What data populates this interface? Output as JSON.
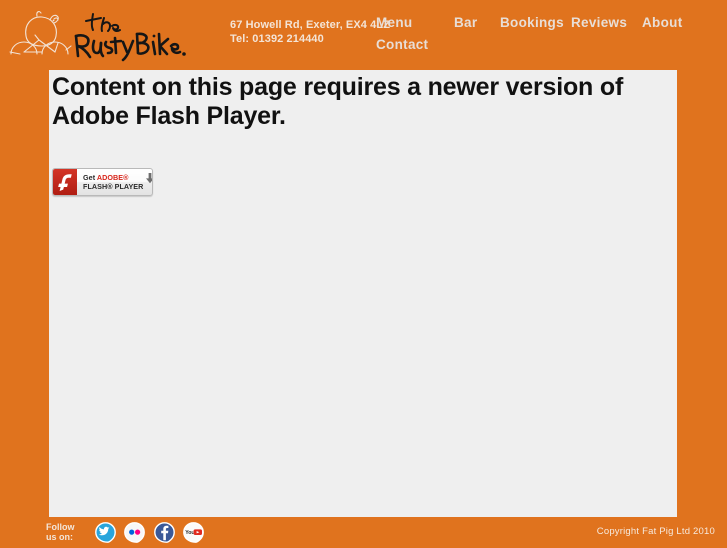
{
  "colors": {
    "brand_orange": "#e0731e",
    "content_background": "#efefef",
    "heading_text": "#111111",
    "nav_text": "#e8ded6",
    "flash_red": "#d8251b",
    "twitter_blue": "#1b9ad6",
    "facebook_blue": "#3b5998",
    "youtube_red": "#e02a20",
    "flickr_pink": "#ff0084"
  },
  "header": {
    "logo": {
      "mark_name": "pig-on-bicycle-drawing",
      "wordmark_text": "The Rusty Bike."
    },
    "contact": {
      "address": "67 Howell Rd, Exeter, EX4 4LZ",
      "telephone": "Tel: 01392 214440"
    },
    "nav": [
      {
        "id": "menu",
        "label": "Menu"
      },
      {
        "id": "bar",
        "label": "Bar"
      },
      {
        "id": "bookings",
        "label": "Bookings"
      },
      {
        "id": "reviews",
        "label": "Reviews"
      },
      {
        "id": "about",
        "label": "About"
      },
      {
        "id": "contact",
        "label": "Contact"
      }
    ]
  },
  "main": {
    "heading": "Content on this page requires a newer version of Adobe Flash Player.",
    "flash_badge": {
      "icon_name": "adobe-flash-logo-icon",
      "line1_prefix": "Get ",
      "line1_brand": "ADOBE®",
      "line2": "FLASH® PLAYER",
      "download_icon_name": "download-arrow-icon"
    }
  },
  "footer": {
    "follow_label": "Follow us on:",
    "social": [
      {
        "id": "twitter",
        "label": "Twitter",
        "icon": "twitter-icon"
      },
      {
        "id": "flickr",
        "label": "Flickr",
        "icon": "flickr-icon"
      },
      {
        "id": "facebook",
        "label": "Facebook",
        "icon": "facebook-icon"
      },
      {
        "id": "youtube",
        "label": "YouTube",
        "icon": "youtube-icon"
      }
    ],
    "copyright": "Copyright Fat Pig Ltd 2010"
  }
}
